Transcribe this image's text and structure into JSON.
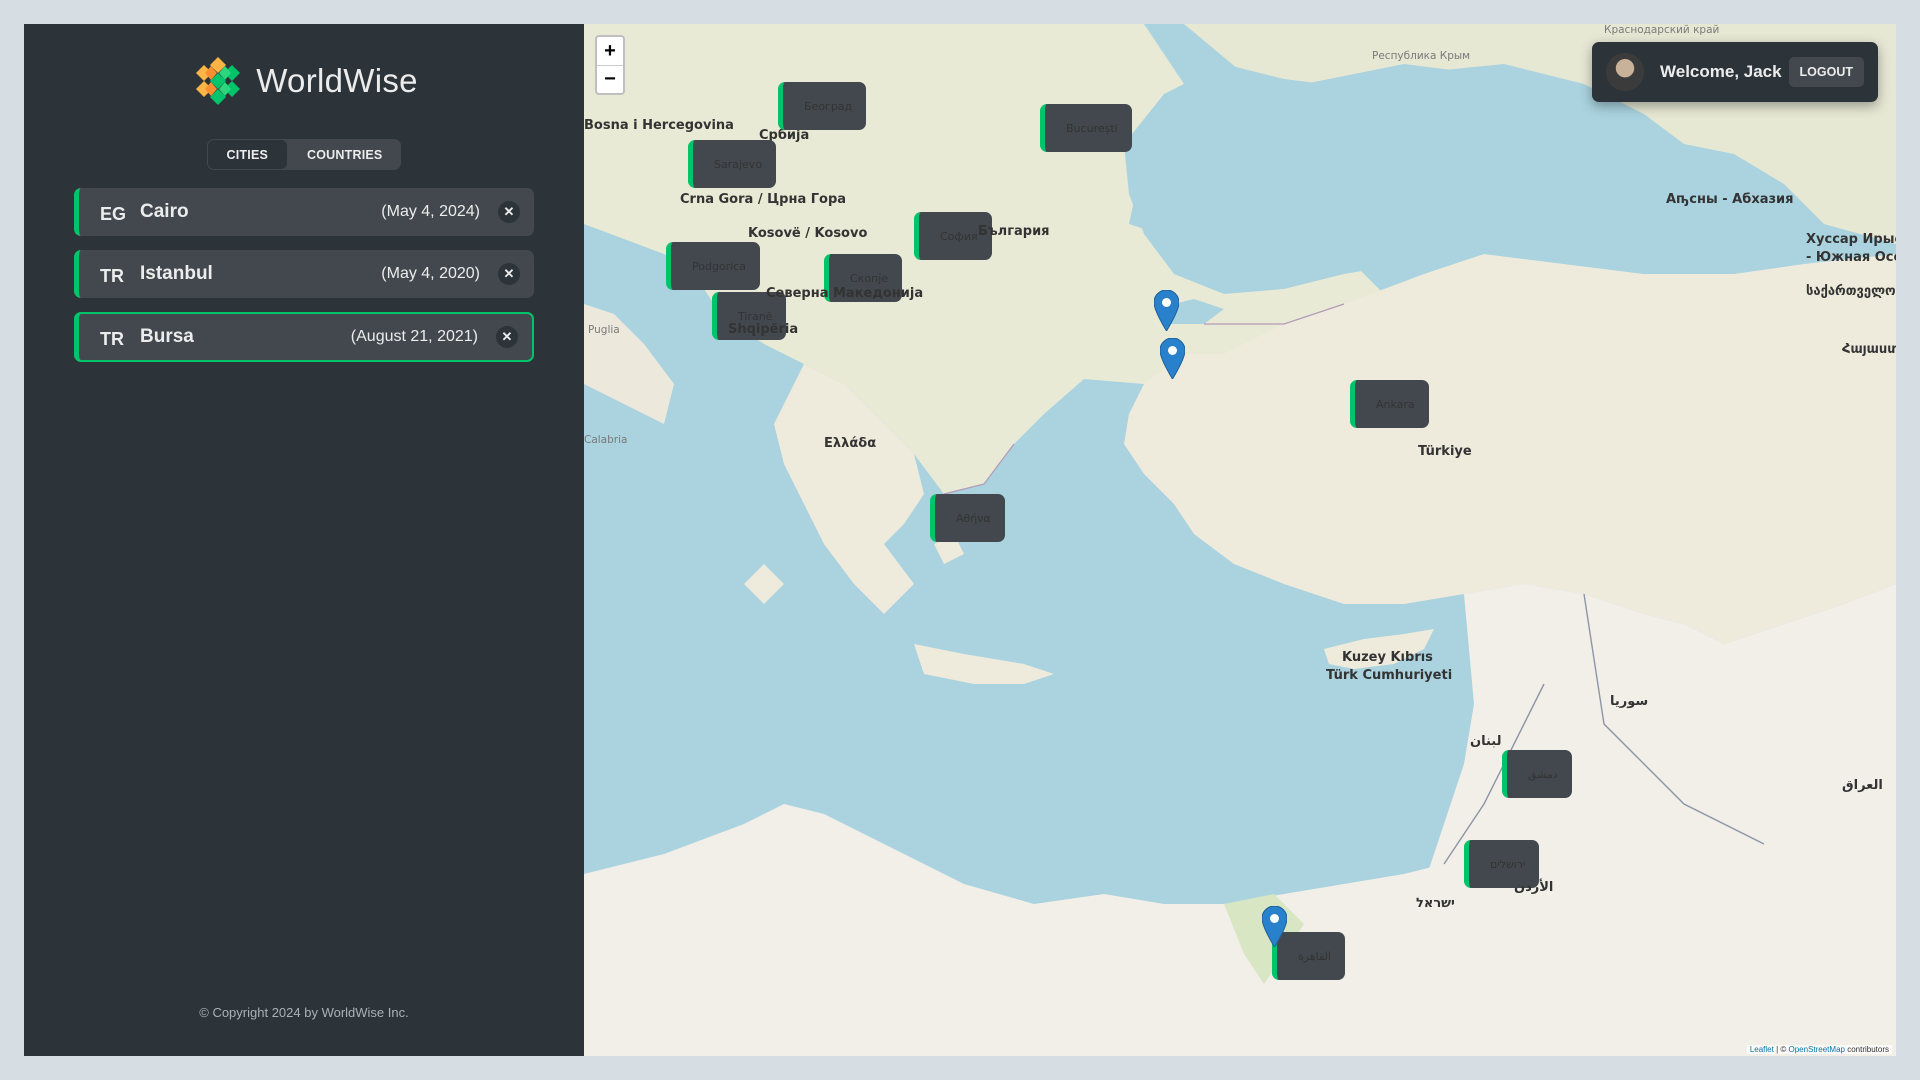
{
  "app": {
    "name": "WorldWise",
    "copyright": "© Copyright 2024 by WorldWise Inc."
  },
  "tabs": [
    {
      "label": "CITIES",
      "active": true
    },
    {
      "label": "COUNTRIES",
      "active": false
    }
  ],
  "cities": [
    {
      "flag": "EG",
      "name": "Cairo",
      "date": "(May 4, 2024)",
      "active": false
    },
    {
      "flag": "TR",
      "name": "Istanbul",
      "date": "(May 4, 2020)",
      "active": false
    },
    {
      "flag": "TR",
      "name": "Bursa",
      "date": "(August 21, 2021)",
      "active": true
    }
  ],
  "user": {
    "welcome": "Welcome, Jack",
    "logout_label": "LOGOUT"
  },
  "map": {
    "zoom_in": "+",
    "zoom_out": "−",
    "attribution_leaflet": "Leaflet",
    "attribution_sep": " | © ",
    "attribution_osm": "OpenStreetMap",
    "attribution_tail": " contributors",
    "labels": {
      "bosnia": "Bosna i Hercegovina",
      "srbija": "Србија",
      "beograd": "Београд",
      "bucuresti": "București",
      "sarajevo": "Sarajevo",
      "crna_gora": "Crna Gora / Црна Гора",
      "kosovo": "Kosovë / Kosovo",
      "sofia": "София",
      "bulgaria": "България",
      "podgorica": "Podgorica",
      "skopje": "Скопје",
      "tirane": "Tiranë",
      "makedonija": "Северна Македонија",
      "shqiperia": "Shqipëria",
      "puglia": "Puglia",
      "calabria": "Calabria",
      "ellada": "Ελλάδα",
      "athina": "Αθήνα",
      "ankara": "Ankara",
      "turkiye": "Türkiye",
      "kibris1": "Kuzey Kıbrıs",
      "kibris2": "Türk Cumhuriyeti",
      "abkhazia": "Аҧсны - Абхазия",
      "ossetia1": "Хуссар Ирыст",
      "ossetia2": "- Южная Осетия",
      "georgia": "საქართველო",
      "armenia": "Հայաստան",
      "syria": "سوريا",
      "lebanon": "لبنان",
      "damascus": "دمشق",
      "israel": "ישראל",
      "jerusalem": "ירושלים",
      "jordan": "الأردن",
      "iraq": "العراق",
      "cairo_label": "القاهرة",
      "krym": "Республика Крым",
      "krasnodar": "Краснодарский край"
    }
  },
  "colors": {
    "sidebar_bg": "#2d3439",
    "card_bg": "#42484d",
    "accent_green": "#00c46a",
    "sea": "#aad3df",
    "land": "#f2efe9"
  }
}
